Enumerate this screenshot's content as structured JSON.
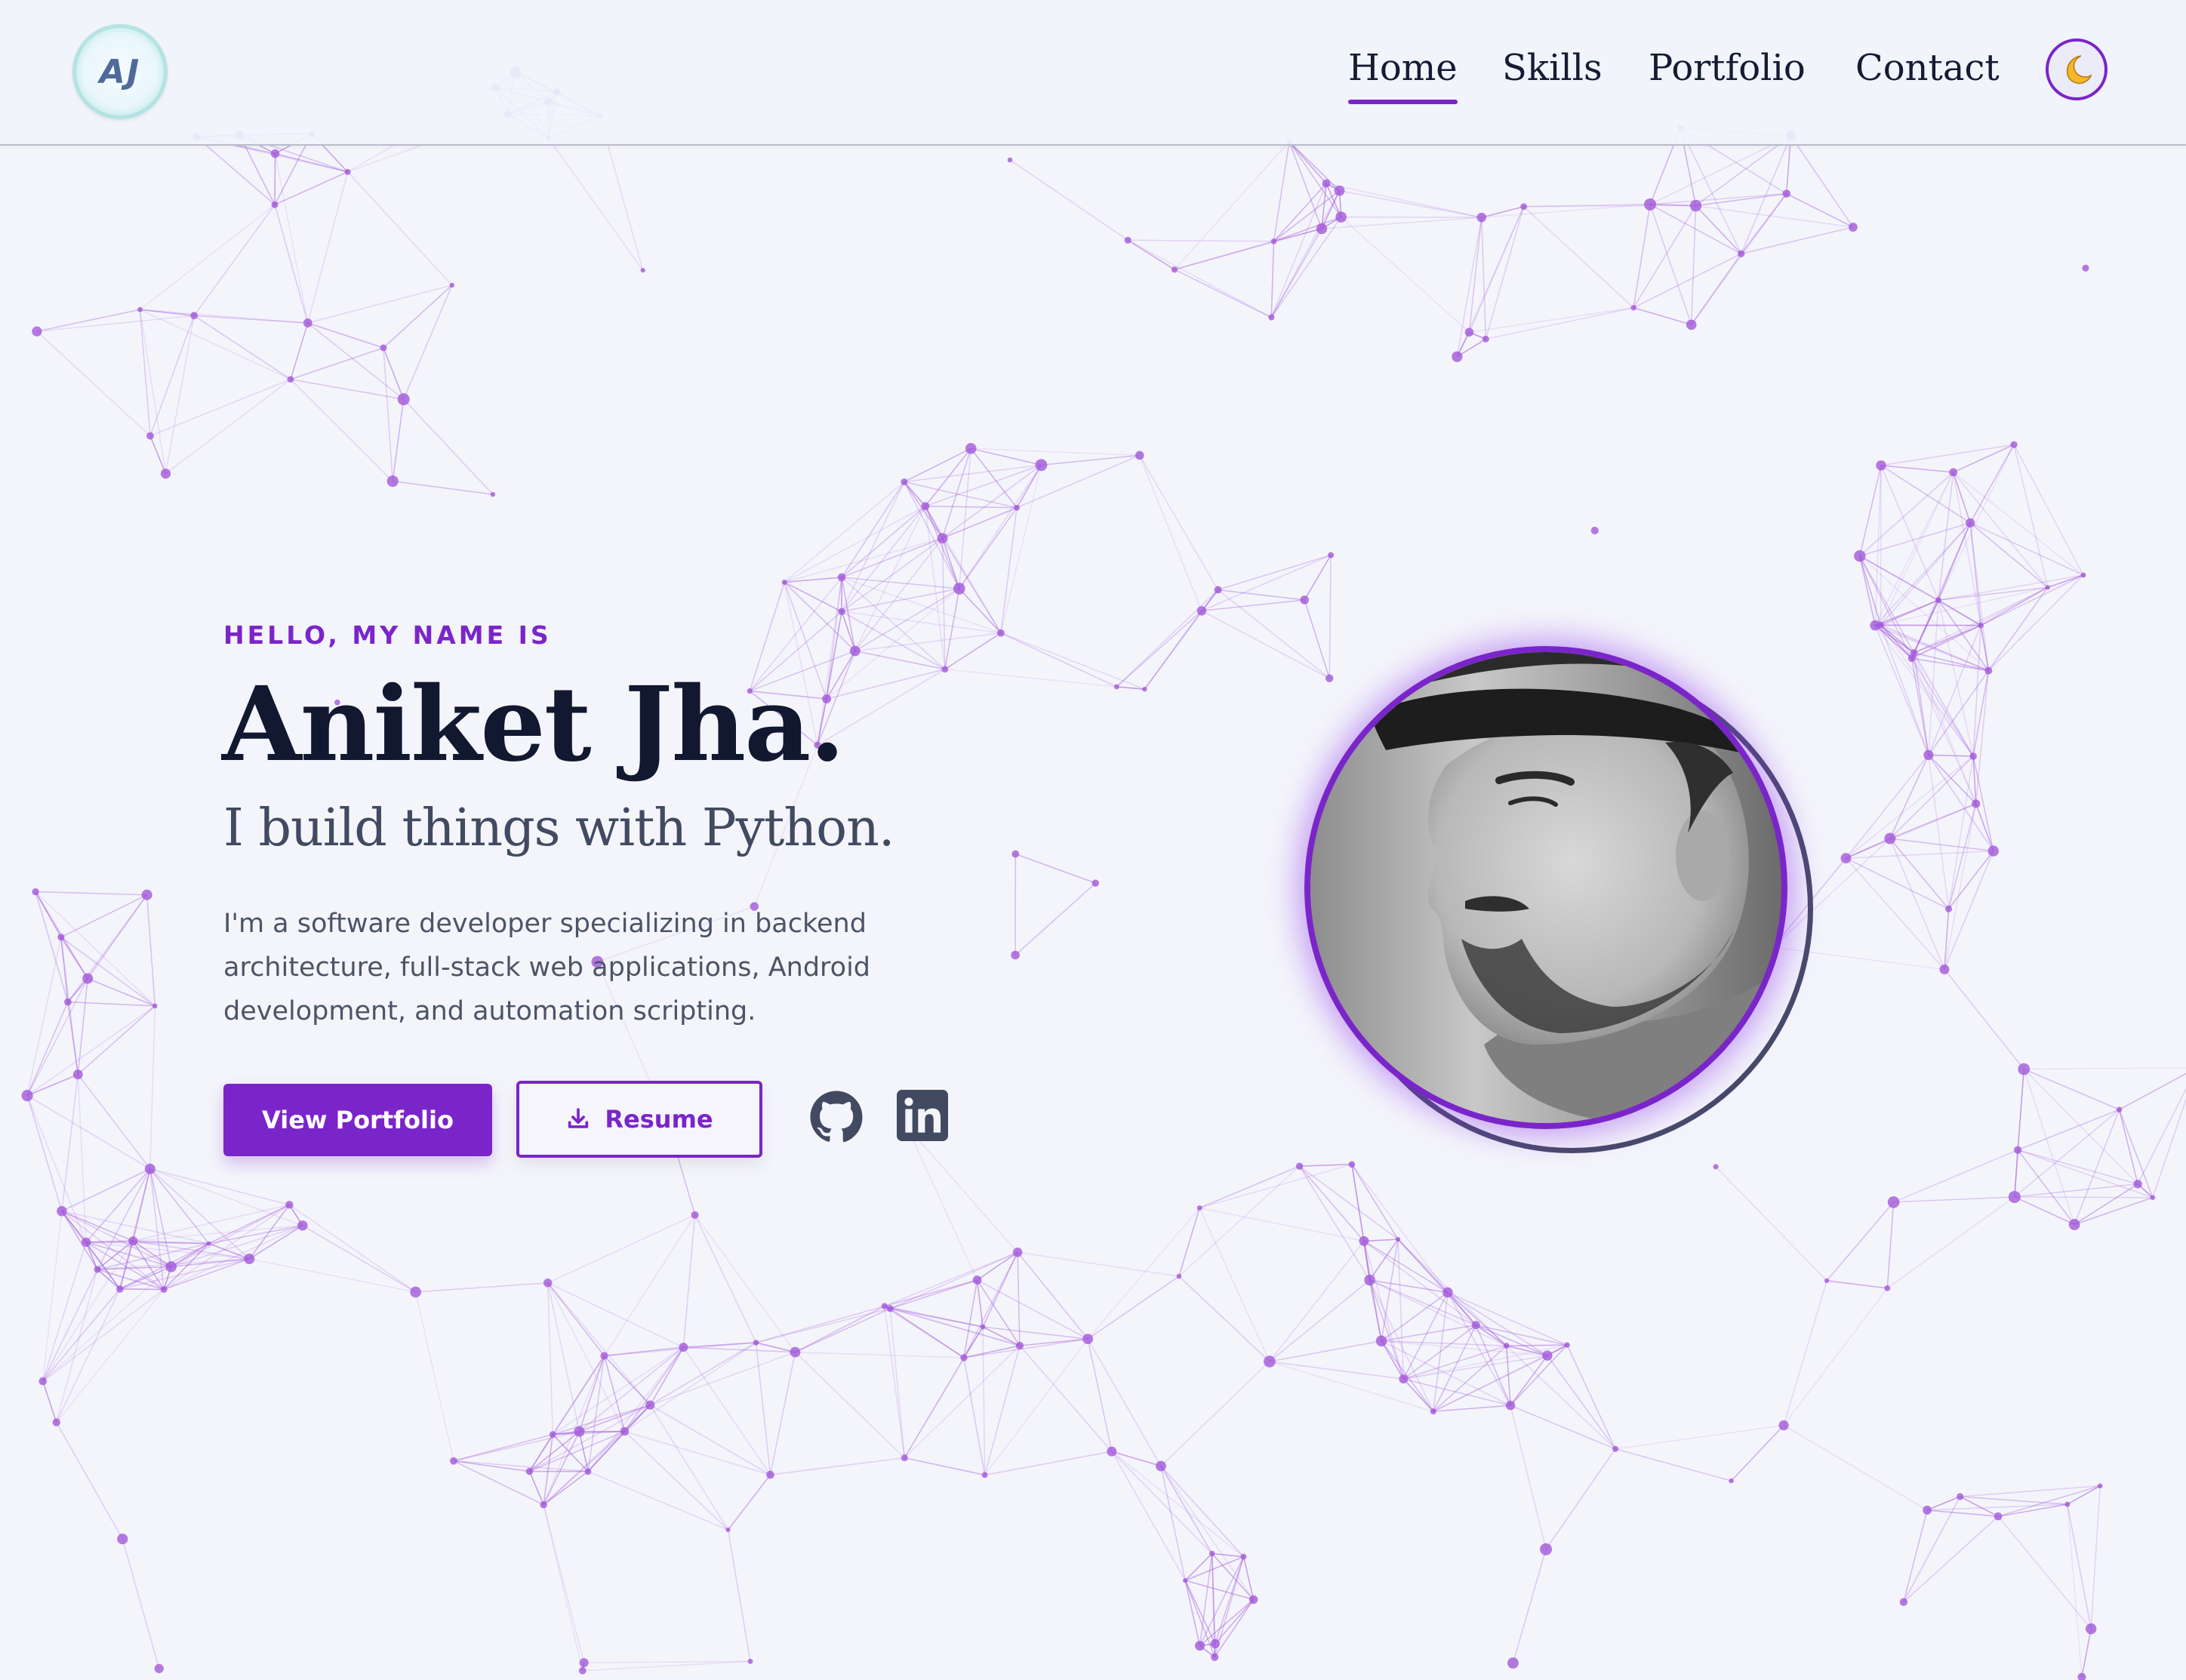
{
  "logo": {
    "text": "AJ"
  },
  "nav": {
    "items": [
      "Home",
      "Skills",
      "Portfolio",
      "Contact"
    ],
    "active": "Home"
  },
  "theme_toggle": {
    "icon": "moon-icon"
  },
  "hero": {
    "greeting": "HELLO, MY NAME IS",
    "name": "Aniket Jha.",
    "tagline": "I build things with Python.",
    "bio_lines": [
      "I'm a software developer specializing in backend",
      "architecture, full-stack web applications, Android",
      "development, and automation scripting."
    ],
    "primary_button": "View Portfolio",
    "secondary_button": "Resume",
    "secondary_button_icon": "download-icon",
    "social_icons": [
      "github-icon",
      "linkedin-icon"
    ]
  },
  "profile": {
    "photo": "profile-photo"
  },
  "colors": {
    "accent": "#7a25c9",
    "background": "#f4f5fb",
    "heading": "#111830",
    "subheading": "#414a60",
    "body_text": "#4c5467",
    "network_node": "#a259d9"
  }
}
